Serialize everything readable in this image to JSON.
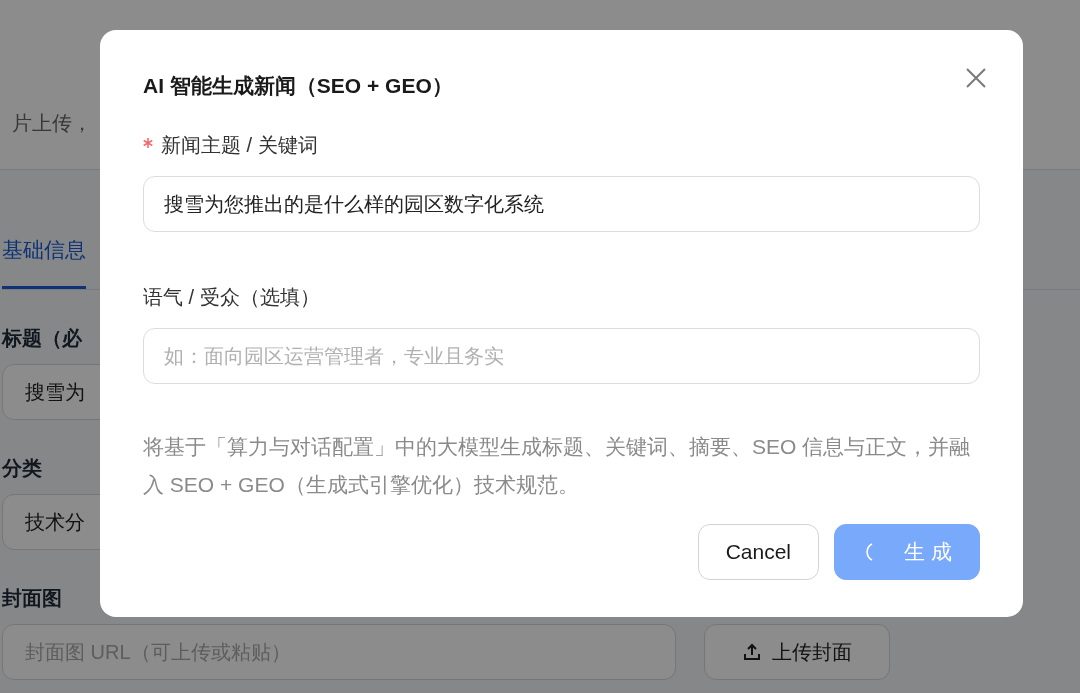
{
  "page": {
    "header_text": "片上传，",
    "tabs": [
      {
        "label": "基础信息",
        "selected": true
      }
    ],
    "fields": [
      {
        "label": "标题（必",
        "value": "搜雪为"
      },
      {
        "label": "分类",
        "value": "技术分"
      },
      {
        "label": "封面图",
        "placeholder": "封面图 URL（可上传或粘贴）",
        "button": "上传封面"
      }
    ]
  },
  "dialog": {
    "title": "AI 智能生成新闻（SEO + GEO）",
    "fields": [
      {
        "label": "新闻主题 / 关键词",
        "required": true,
        "value": "搜雪为您推出的是什么样的园区数字化系统"
      },
      {
        "label": "语气 / 受众（选填）",
        "required": false,
        "placeholder": "如：面向园区运营管理者，专业且务实"
      }
    ],
    "note": "将基于「算力与对话配置」中的大模型生成标题、关键词、摘要、SEO 信息与正文，并融入 SEO + GEO（生成式引擎优化）技术规范。",
    "buttons": [
      {
        "label": "Cancel",
        "kind": "secondary",
        "loading": false
      },
      {
        "label": "生 成",
        "kind": "primary",
        "loading": true
      }
    ]
  }
}
